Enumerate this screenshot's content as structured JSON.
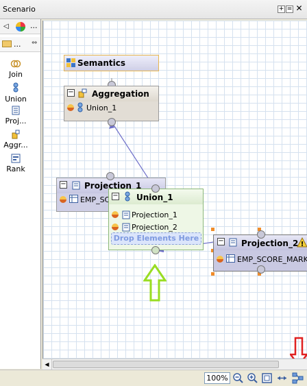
{
  "window": {
    "title": "Scenario"
  },
  "palette": {
    "drawer_dots": "...",
    "head_dots": "...",
    "tools": [
      {
        "label": "Join"
      },
      {
        "label": "Union"
      },
      {
        "label": "Proj..."
      },
      {
        "label": "Aggr..."
      },
      {
        "label": "Rank"
      }
    ]
  },
  "nodes": {
    "semantics": {
      "title": "Semantics"
    },
    "aggregation": {
      "title": "Aggregation",
      "inputs": [
        "Union_1"
      ]
    },
    "projection_1": {
      "title": "Projection_1",
      "row": "EMP_SCO"
    },
    "union_1": {
      "title": "Union_1",
      "inputs": [
        "Projection_1",
        "Projection_2"
      ],
      "drop_hint": "Drop Elements Here"
    },
    "projection_2": {
      "title": "Projection_2",
      "row": "EMP_SCORE_MARK."
    }
  },
  "statusbar": {
    "zoom": "100%"
  },
  "colors": {
    "grid": "#d5e1ef",
    "edge": "#6f6fc9",
    "callout_green": "#99dd22",
    "callout_red": "#e02020"
  }
}
